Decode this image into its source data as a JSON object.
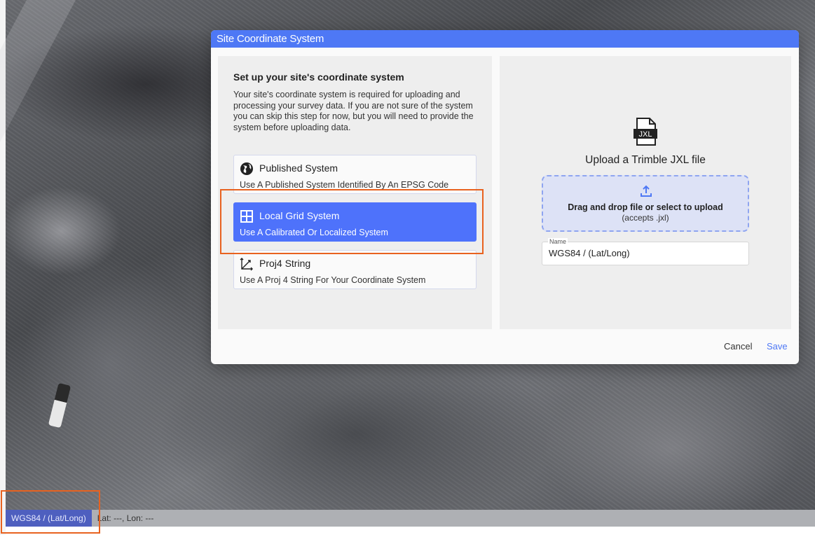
{
  "dialog": {
    "title": "Site Coordinate System",
    "heading": "Set up your site's coordinate system",
    "description": "Your site's coordinate system is required for uploading and processing your survey data. If you are not sure of the system you can skip this step for now, but you will need to provide the system before uploading data.",
    "options": [
      {
        "title": "Published System",
        "subtitle": "Use A Published System Identified By An EPSG Code",
        "icon": "globe-icon",
        "selected": false
      },
      {
        "title": "Local Grid System",
        "subtitle": "Use A Calibrated Or Localized System",
        "icon": "grid-icon",
        "selected": true
      },
      {
        "title": "Proj4 String",
        "subtitle": "Use A Proj 4 String For Your Coordinate System",
        "icon": "axes-icon",
        "selected": false
      }
    ],
    "upload": {
      "file_badge": "JXL",
      "title": "Upload a Trimble JXL file",
      "drop_main": "Drag and drop file or select to upload",
      "drop_sub": "(accepts .jxl)",
      "name_label": "Name",
      "name_value": "WGS84 / (Lat/Long)"
    },
    "cancel_label": "Cancel",
    "save_label": "Save"
  },
  "status_bar": {
    "crs_label": "WGS84 / (Lat/Long)",
    "coords": "Lat: ---, Lon: ---"
  },
  "colors": {
    "accent": "#4e78f5",
    "selected_option": "#4e72fb",
    "highlight": "#e8621f",
    "status_crs": "#4e5fbf"
  }
}
